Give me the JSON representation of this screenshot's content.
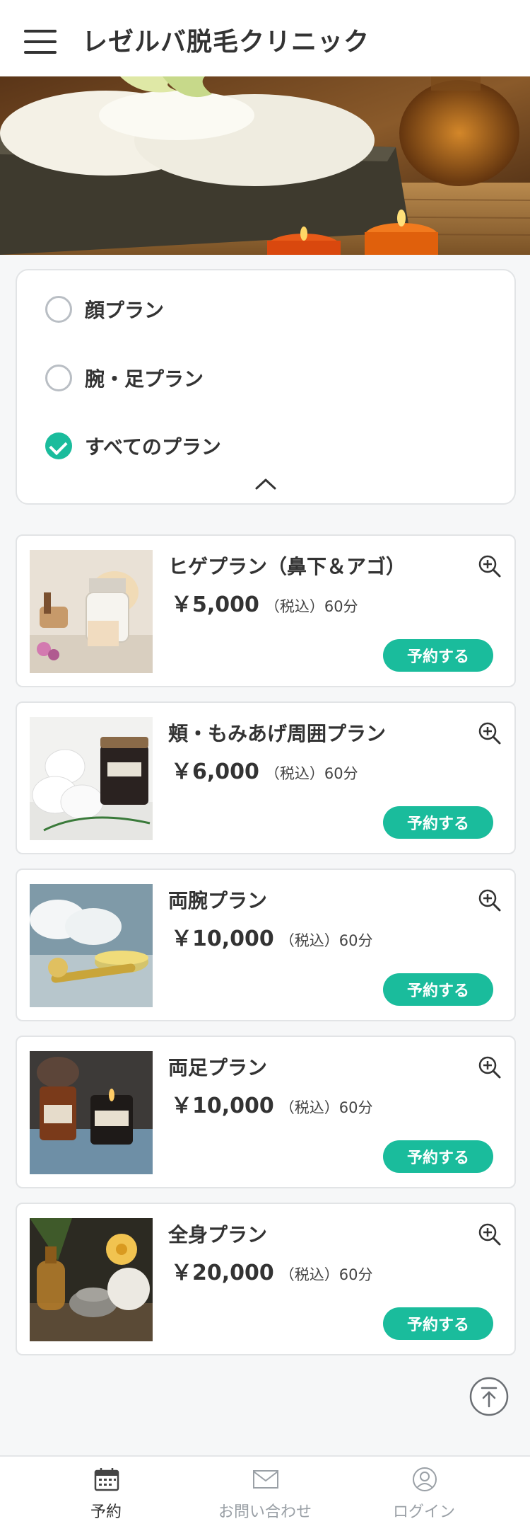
{
  "header": {
    "title": "レゼルバ脱毛クリニック"
  },
  "filter": {
    "options": [
      {
        "label": "顔プラン",
        "checked": false
      },
      {
        "label": "腕・足プラン",
        "checked": false
      },
      {
        "label": "すべてのプラン",
        "checked": true
      }
    ]
  },
  "plans": [
    {
      "name": "ヒゲプラン（鼻下＆アゴ）",
      "price": "￥5,000",
      "tax": "（税込）",
      "duration": "60分",
      "button": "予約する",
      "image_icon": "bath-salt-jar-image"
    },
    {
      "name": "頬・もみあげ周囲プラン",
      "price": "￥6,000",
      "tax": "（税込）",
      "duration": "60分",
      "button": "予約する",
      "image_icon": "towels-candle-image"
    },
    {
      "name": "両腕プラン",
      "price": "￥10,000",
      "tax": "（税込）",
      "duration": "60分",
      "button": "予約する",
      "image_icon": "towels-oil-image"
    },
    {
      "name": "両足プラン",
      "price": "￥10,000",
      "tax": "（税込）",
      "duration": "60分",
      "button": "予約する",
      "image_icon": "apothecary-candles-image"
    },
    {
      "name": "全身プラン",
      "price": "￥20,000",
      "tax": "（税込）",
      "duration": "60分",
      "button": "予約する",
      "image_icon": "spa-stones-flowers-image"
    }
  ],
  "bottom_nav": {
    "items": [
      {
        "label": "予約",
        "icon": "calendar-icon",
        "active": true
      },
      {
        "label": "お問い合わせ",
        "icon": "mail-icon",
        "active": false
      },
      {
        "label": "ログイン",
        "icon": "user-icon",
        "active": false
      }
    ]
  },
  "colors": {
    "accent": "#1abc9c",
    "text": "#333333",
    "nav_inactive": "#9aa0a6",
    "border": "#e2e4e6"
  }
}
